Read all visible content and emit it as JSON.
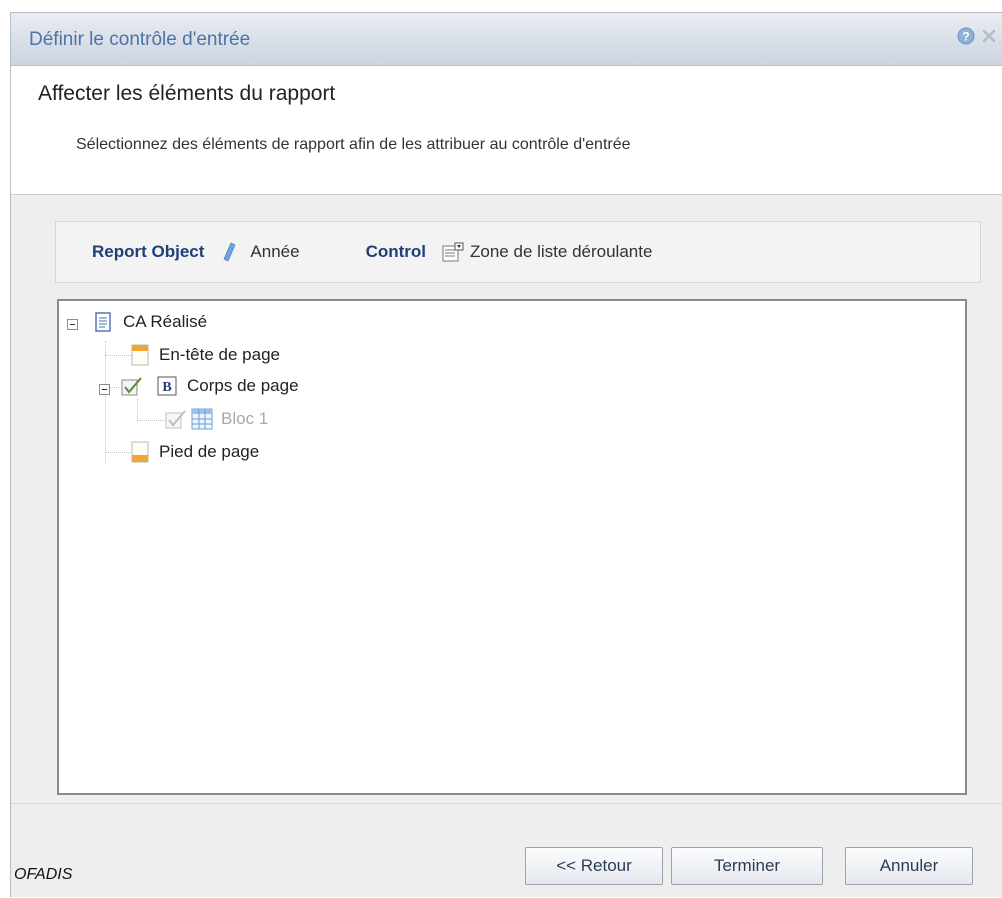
{
  "dialog": {
    "title": "Définir le contrôle d'entrée"
  },
  "header": {
    "title": "Affecter les éléments du rapport",
    "subtitle": "Sélectionnez des éléments de rapport afin de les attribuer au contrôle d'entrée"
  },
  "info": {
    "report_object_label": "Report Object",
    "report_object_value": "Année",
    "control_label": "Control",
    "control_value": "Zone de liste déroulante"
  },
  "tree": {
    "root": "CA Réalisé",
    "header": "En-tête de page",
    "body": "Corps de page",
    "block": "Bloc 1",
    "footer": "Pied de page"
  },
  "buttons": {
    "back": "<< Retour",
    "finish": "Terminer",
    "cancel": "Annuler"
  },
  "brand": "OFADIS",
  "colors": {
    "title_text": "#4d73a7",
    "info_label": "#1f3f78",
    "disabled_text": "#a9a9a9"
  }
}
